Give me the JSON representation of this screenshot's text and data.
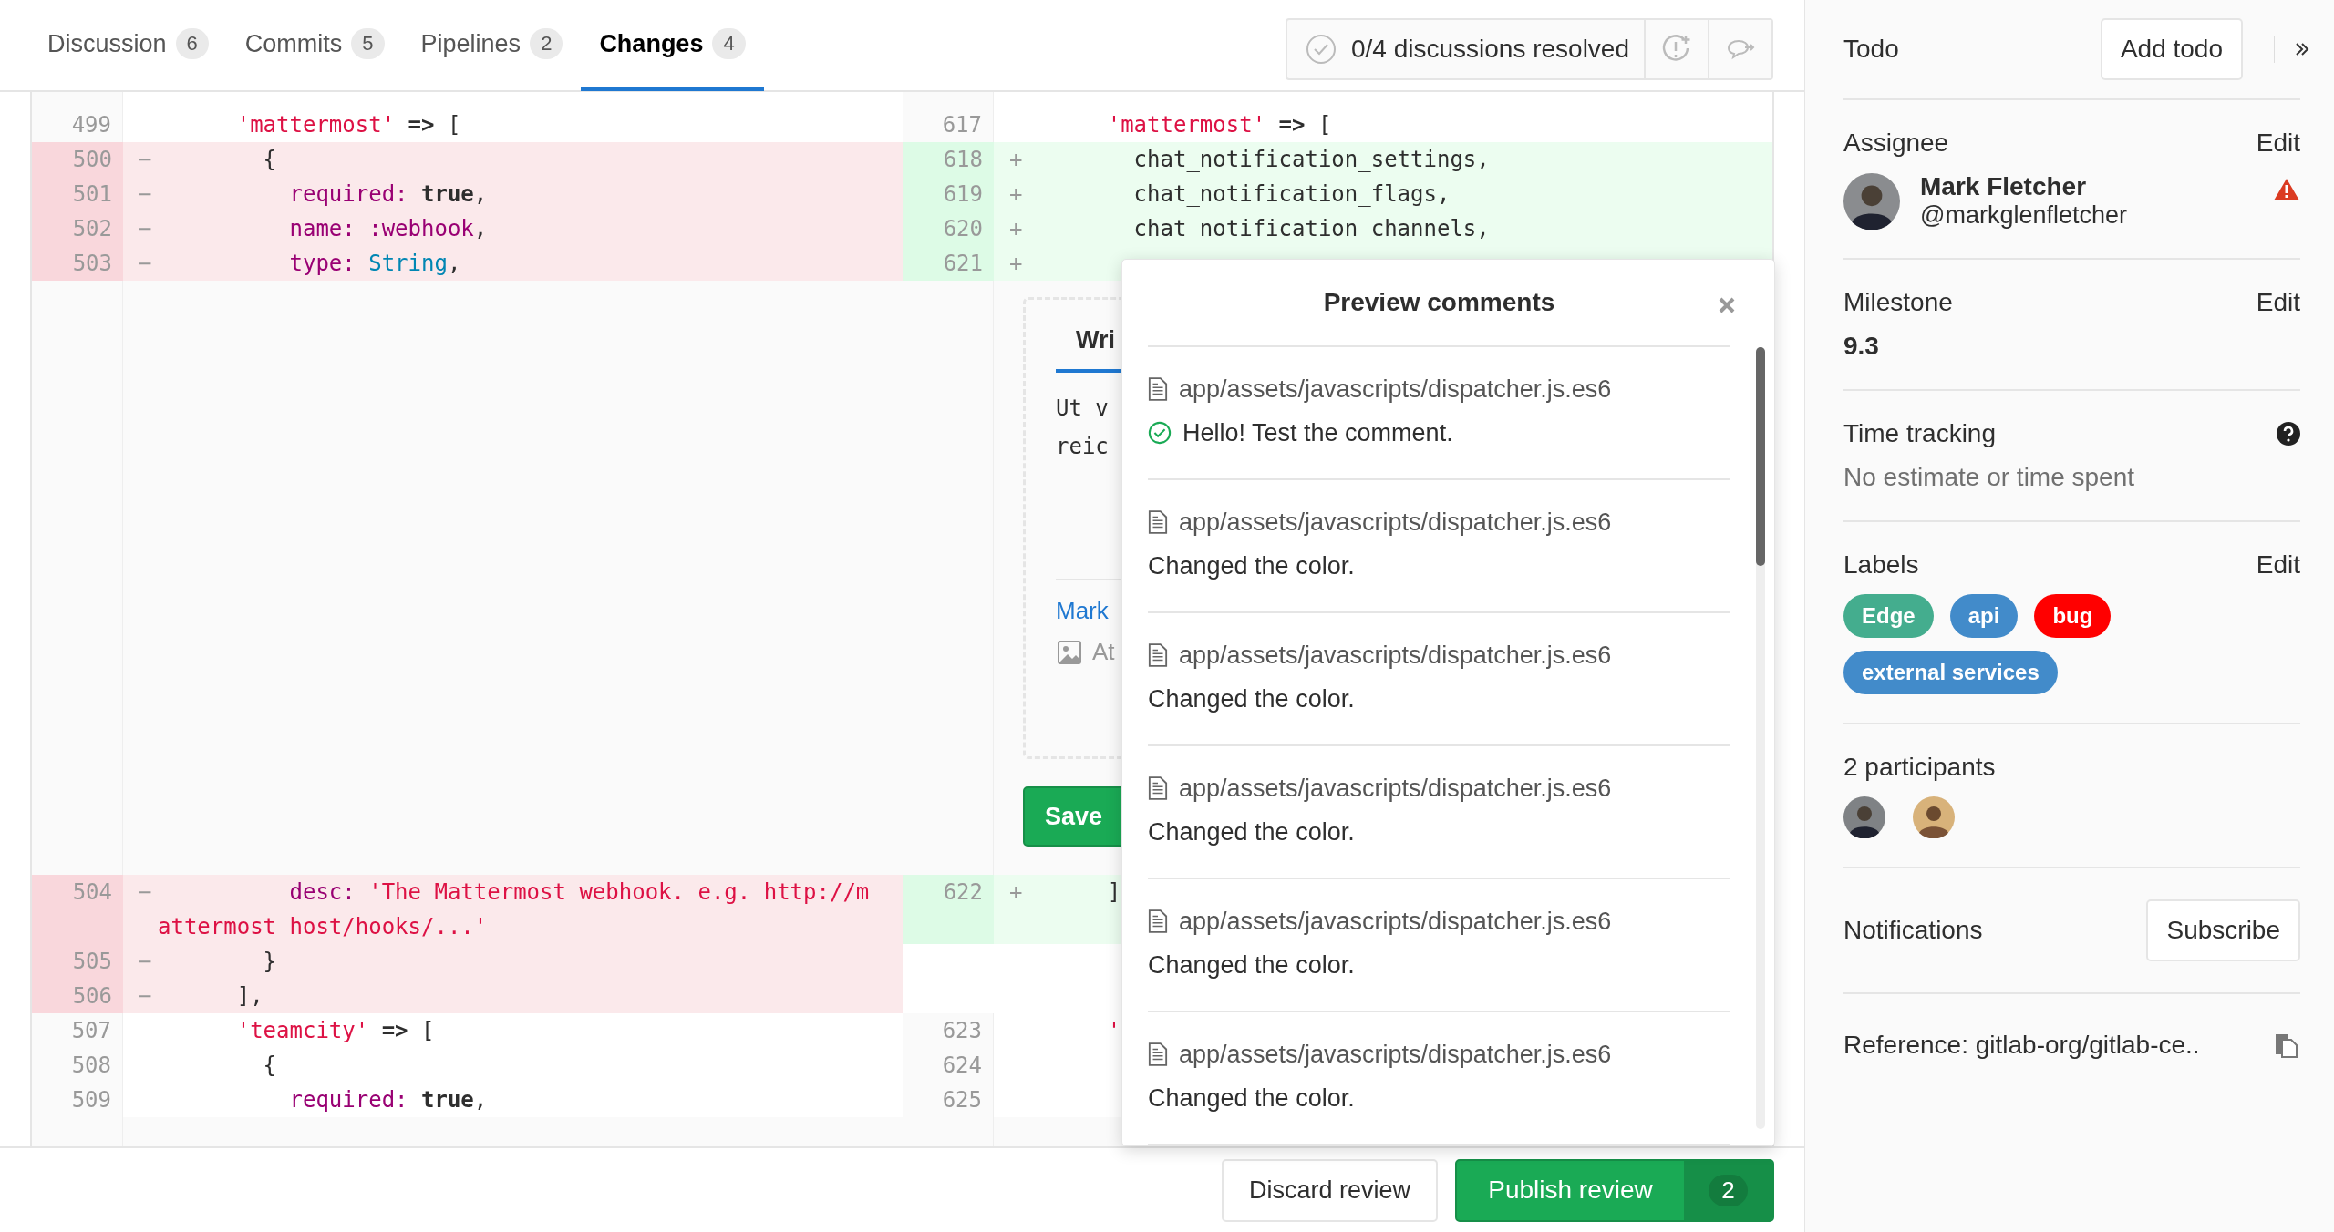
{
  "tabs": [
    {
      "label": "Discussion",
      "count": "6",
      "selected": false
    },
    {
      "label": "Commits",
      "count": "5",
      "selected": false
    },
    {
      "label": "Pipelines",
      "count": "2",
      "selected": false
    },
    {
      "label": "Changes",
      "count": "4",
      "selected": true
    }
  ],
  "discussions": {
    "status": "0/4 discussions resolved"
  },
  "diff": {
    "rows": [
      {
        "kind": "line",
        "left": {
          "num": "499",
          "kind": "context",
          "code": [
            {
              "t": "      'mattermost' ",
              "kind": "string"
            },
            {
              "t": "=>",
              "kind": "keyword"
            },
            {
              "t": " [",
              "kind": "plain"
            }
          ]
        },
        "right": {
          "num": "617",
          "kind": "context",
          "code": [
            {
              "t": "      'mattermost' ",
              "kind": "string"
            },
            {
              "t": "=>",
              "kind": "keyword"
            },
            {
              "t": " [",
              "kind": "plain"
            }
          ]
        }
      },
      {
        "kind": "line",
        "left": {
          "num": "500",
          "kind": "del",
          "sign": "−",
          "code": [
            {
              "t": "        {",
              "kind": "plain"
            }
          ]
        },
        "right": {
          "num": "618",
          "kind": "add",
          "sign": "+",
          "code": [
            {
              "t": "        chat_notification_settings,",
              "kind": "plain"
            }
          ]
        }
      },
      {
        "kind": "line",
        "left": {
          "num": "501",
          "kind": "del",
          "sign": "−",
          "code": [
            {
              "t": "          required: ",
              "kind": "symbol"
            },
            {
              "t": "true",
              "kind": "keyword"
            },
            {
              "t": ",",
              "kind": "plain"
            }
          ]
        },
        "right": {
          "num": "619",
          "kind": "add",
          "sign": "+",
          "code": [
            {
              "t": "        chat_notification_flags,",
              "kind": "plain"
            }
          ]
        }
      },
      {
        "kind": "line",
        "left": {
          "num": "502",
          "kind": "del",
          "sign": "−",
          "code": [
            {
              "t": "          name: :webhook",
              "kind": "symbol"
            },
            {
              "t": ",",
              "kind": "plain"
            }
          ]
        },
        "right": {
          "num": "620",
          "kind": "add",
          "sign": "+",
          "code": [
            {
              "t": "        chat_notification_channels,",
              "kind": "plain"
            }
          ]
        }
      },
      {
        "kind": "line",
        "left": {
          "num": "503",
          "kind": "del",
          "sign": "−",
          "code": [
            {
              "t": "          type: ",
              "kind": "symbol"
            },
            {
              "t": "String",
              "kind": "constant"
            },
            {
              "t": ",",
              "kind": "plain"
            }
          ]
        },
        "right": {
          "num": "621",
          "kind": "add",
          "sign": "+"
        }
      },
      {
        "kind": "comment_gap"
      },
      {
        "kind": "line",
        "left": {
          "num": "504",
          "kind": "del",
          "sign": "−",
          "code": [
            {
              "t": "          desc: ",
              "kind": "symbol"
            },
            {
              "t": "'The Mattermost webhook. e.g. http://mattermost_host/hooks/...'",
              "kind": "string"
            }
          ]
        },
        "right": {
          "num": "622",
          "kind": "add",
          "sign": "+",
          "code": [
            {
              "t": "      ]",
              "kind": "plain"
            }
          ]
        }
      },
      {
        "kind": "line",
        "left": {
          "num": "505",
          "kind": "del",
          "sign": "−",
          "code": [
            {
              "t": "        }",
              "kind": "plain"
            }
          ]
        },
        "right": {
          "kind": "empty"
        }
      },
      {
        "kind": "line",
        "left": {
          "num": "506",
          "kind": "del",
          "sign": "−",
          "code": [
            {
              "t": "      ],",
              "kind": "plain"
            }
          ]
        },
        "right": {
          "kind": "empty"
        }
      },
      {
        "kind": "line",
        "left": {
          "num": "507",
          "kind": "context",
          "code": [
            {
              "t": "      'teamcity' ",
              "kind": "string"
            },
            {
              "t": "=>",
              "kind": "keyword"
            },
            {
              "t": " [",
              "kind": "plain"
            }
          ]
        },
        "right": {
          "num": "623",
          "kind": "context",
          "code": [
            {
              "t": "      '",
              "kind": "string"
            }
          ]
        }
      },
      {
        "kind": "line",
        "left": {
          "num": "508",
          "kind": "context",
          "code": [
            {
              "t": "        {",
              "kind": "plain"
            }
          ]
        },
        "right": {
          "num": "624",
          "kind": "context"
        }
      },
      {
        "kind": "line",
        "left": {
          "num": "509",
          "kind": "context",
          "code": [
            {
              "t": "          required: ",
              "kind": "symbol"
            },
            {
              "t": "true",
              "kind": "keyword"
            },
            {
              "t": ",",
              "kind": "plain"
            }
          ]
        },
        "right": {
          "num": "625",
          "kind": "context"
        }
      }
    ]
  },
  "comment_form": {
    "tab": "Wri",
    "text_lines": [
      "Ut v",
      "reic"
    ],
    "markdown_link": "Mark",
    "attach": "At",
    "save_button": "Save"
  },
  "preview": {
    "title": "Preview comments",
    "comments": [
      {
        "file": "app/assets/javascripts/dispatcher.js.es6",
        "text": "Hello! Test the comment.",
        "resolved": true
      },
      {
        "file": "app/assets/javascripts/dispatcher.js.es6",
        "text": "Changed the color.",
        "resolved": false
      },
      {
        "file": "app/assets/javascripts/dispatcher.js.es6",
        "text": "Changed the color.",
        "resolved": false
      },
      {
        "file": "app/assets/javascripts/dispatcher.js.es6",
        "text": "Changed the color.",
        "resolved": false
      },
      {
        "file": "app/assets/javascripts/dispatcher.js.es6",
        "text": "Changed the color.",
        "resolved": false
      },
      {
        "file": "app/assets/javascripts/dispatcher.js.es6",
        "text": "Changed the color.",
        "resolved": false
      }
    ]
  },
  "review_bar": {
    "discard": "Discard review",
    "publish": "Publish review",
    "count": "2"
  },
  "sidebar": {
    "todo": {
      "label": "Todo",
      "button": "Add todo"
    },
    "assignee": {
      "title": "Assignee",
      "edit": "Edit",
      "name": "Mark Fletcher",
      "username": "@markglenfletcher"
    },
    "milestone": {
      "title": "Milestone",
      "edit": "Edit",
      "value": "9.3"
    },
    "time_tracking": {
      "title": "Time tracking",
      "value": "No estimate or time spent"
    },
    "labels": {
      "title": "Labels",
      "edit": "Edit",
      "items": [
        {
          "name": "Edge",
          "color": "#44ad8e"
        },
        {
          "name": "api",
          "color": "#428bca"
        },
        {
          "name": "bug",
          "color": "#ff0000"
        },
        {
          "name": "external services",
          "color": "#428bca"
        }
      ]
    },
    "participants": {
      "title": "2 participants",
      "avatars": [
        {
          "kind": "avatar"
        },
        {
          "kind": "avatar"
        }
      ]
    },
    "notifications": {
      "label": "Notifications",
      "button": "Subscribe"
    },
    "reference": "Reference: gitlab-org/gitlab-ce.."
  }
}
